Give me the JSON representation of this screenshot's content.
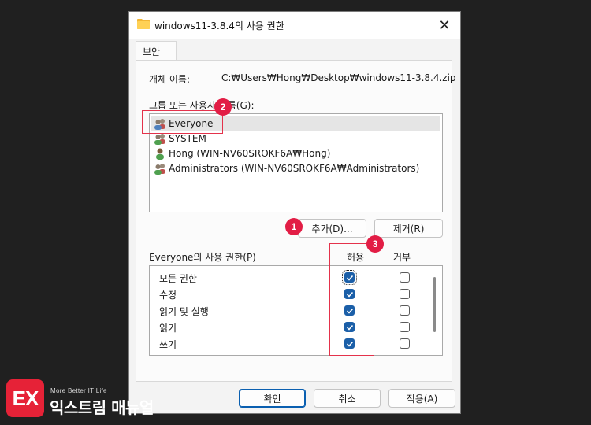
{
  "window": {
    "title": "windows11-3.8.4의 사용 권한",
    "close_glyph": "✕"
  },
  "tab": {
    "label": "보안"
  },
  "object": {
    "label": "개체 이름:",
    "value": "C:₩Users₩Hong₩Desktop₩windows11-3.8.4.zip"
  },
  "groups": {
    "label": "그룹 또는 사용자 이름(G):",
    "items": [
      {
        "name": "Everyone",
        "icon": "group-icon"
      },
      {
        "name": "SYSTEM",
        "icon": "group-icon"
      },
      {
        "name": "Hong (WIN-NV60SROKF6A₩Hong)",
        "icon": "user-icon"
      },
      {
        "name": "Administrators (WIN-NV60SROKF6A₩Administrators)",
        "icon": "group-icon"
      }
    ]
  },
  "buttons": {
    "add": "추가(D)...",
    "remove": "제거(R)",
    "ok": "확인",
    "cancel": "취소",
    "apply": "적용(A)"
  },
  "permissions": {
    "header": "Everyone의 사용 권한(P)",
    "allow_label": "허용",
    "deny_label": "거부",
    "rows": [
      {
        "name": "모든 권한",
        "allow": true,
        "deny": false
      },
      {
        "name": "수정",
        "allow": true,
        "deny": false
      },
      {
        "name": "읽기 및 실행",
        "allow": true,
        "deny": false
      },
      {
        "name": "읽기",
        "allow": true,
        "deny": false
      },
      {
        "name": "쓰기",
        "allow": true,
        "deny": false
      }
    ]
  },
  "annotations": {
    "badge1": "1",
    "badge2": "2",
    "badge3": "3",
    "color": "#e21d45"
  },
  "brand": {
    "logo": "EX",
    "tagline": "More Better IT Life",
    "name": "익스트림 매뉴얼"
  }
}
